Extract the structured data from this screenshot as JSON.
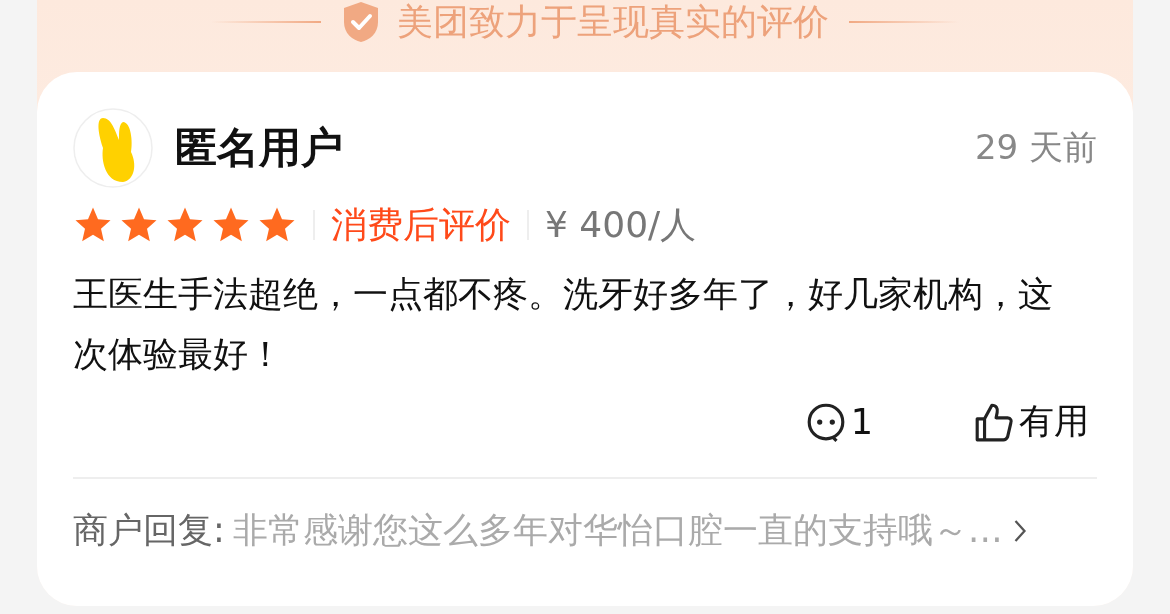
{
  "banner": {
    "text": "美团致力于呈现真实的评价"
  },
  "review": {
    "user": "匿名用户",
    "time": "29 天前",
    "stars": 5,
    "tag": "消费后评价",
    "price": "¥ 400/人",
    "text": "王医生手法超绝，一点都不疼。洗牙好多年了，好几家机构，这次体验最好！",
    "comments": "1",
    "useful": "有用"
  },
  "reply": {
    "label": "商户回复:",
    "text": "非常感谢您这么多年对华怡口腔一直的支持哦～…"
  }
}
